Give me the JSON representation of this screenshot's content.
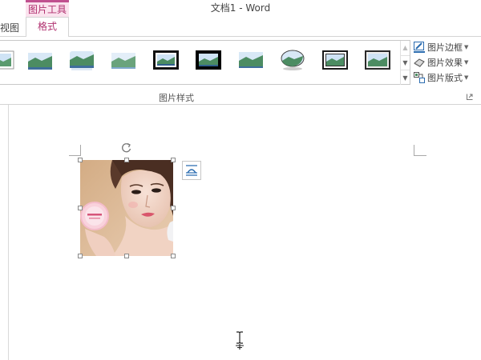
{
  "title_bar": {
    "document_title": "文档1 - Word"
  },
  "context_tab_group": {
    "label": "图片工具"
  },
  "tabs": {
    "view_partial": "视图",
    "format": "格式"
  },
  "ribbon": {
    "picture_styles_group": {
      "label": "图片样式",
      "gallery_styles": [
        "simple-frame-white",
        "beveled-matte",
        "reflected-rounded",
        "soft-edge",
        "thick-black-frame",
        "black-border",
        "simple-frame-blue",
        "oval",
        "double-frame-black",
        "metal-frame"
      ]
    },
    "commands": [
      {
        "label": "图片边框",
        "icon": "picture-border-icon"
      },
      {
        "label": "图片效果",
        "icon": "picture-effects-icon"
      },
      {
        "label": "图片版式",
        "icon": "picture-layout-icon"
      }
    ]
  },
  "document": {
    "picture": {
      "description_icon": "photo",
      "selected": true
    },
    "layout_options_icon": "layout-options-icon",
    "cursor_icon": "ibeam-icon"
  },
  "colors": {
    "accent": "#b0306f",
    "context_tab_bg": "#fbe3ee",
    "ribbon_border": "#d4d4d4"
  }
}
